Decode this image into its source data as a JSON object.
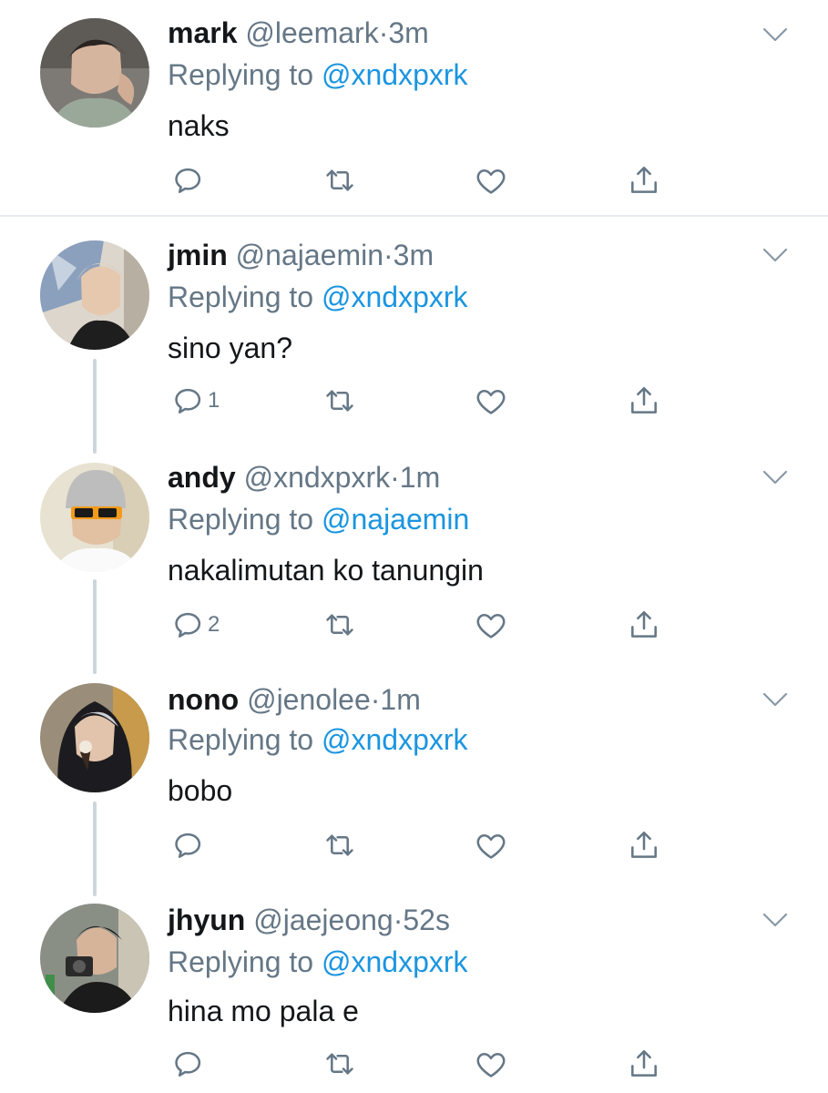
{
  "colors": {
    "name": "#14171a",
    "secondary": "#657786",
    "mention": "#1b95e0",
    "thread_line": "#ccd6dd",
    "divider": "#e6ecf0"
  },
  "tweets": [
    {
      "name": "mark",
      "handle": "@leemark",
      "dot": "·",
      "time": "3m",
      "replying_prefix": "Replying to",
      "replying_to": "@xndxpxrk",
      "text": "naks",
      "reply_count": "",
      "icons": [
        "reply-icon",
        "retweet-icon",
        "like-icon",
        "share-icon",
        "chevron-down-icon"
      ]
    },
    {
      "name": "jmin",
      "handle": "@najaemin",
      "dot": "·",
      "time": "3m",
      "replying_prefix": "Replying to",
      "replying_to": "@xndxpxrk",
      "text": "sino yan?",
      "reply_count": "1",
      "icons": [
        "reply-icon",
        "retweet-icon",
        "like-icon",
        "share-icon",
        "chevron-down-icon"
      ]
    },
    {
      "name": "andy",
      "handle": "@xndxpxrk",
      "dot": "·",
      "time": "1m",
      "replying_prefix": "Replying to",
      "replying_to": "@najaemin",
      "text": "nakalimutan ko tanungin",
      "reply_count": "2",
      "icons": [
        "reply-icon",
        "retweet-icon",
        "like-icon",
        "share-icon",
        "chevron-down-icon"
      ]
    },
    {
      "name": "nono",
      "handle": "@jenolee",
      "dot": "·",
      "time": "1m",
      "replying_prefix": "Replying to",
      "replying_to": "@xndxpxrk",
      "text": "bobo",
      "reply_count": "",
      "icons": [
        "reply-icon",
        "retweet-icon",
        "like-icon",
        "share-icon",
        "chevron-down-icon"
      ]
    },
    {
      "name": "jhyun",
      "handle": "@jaejeong",
      "dot": "·",
      "time": "52s",
      "replying_prefix": "Replying to",
      "replying_to": "@xndxpxrk",
      "text": "hina mo pala e",
      "reply_count": "",
      "icons": [
        "reply-icon",
        "retweet-icon",
        "like-icon",
        "share-icon",
        "chevron-down-icon"
      ]
    }
  ]
}
